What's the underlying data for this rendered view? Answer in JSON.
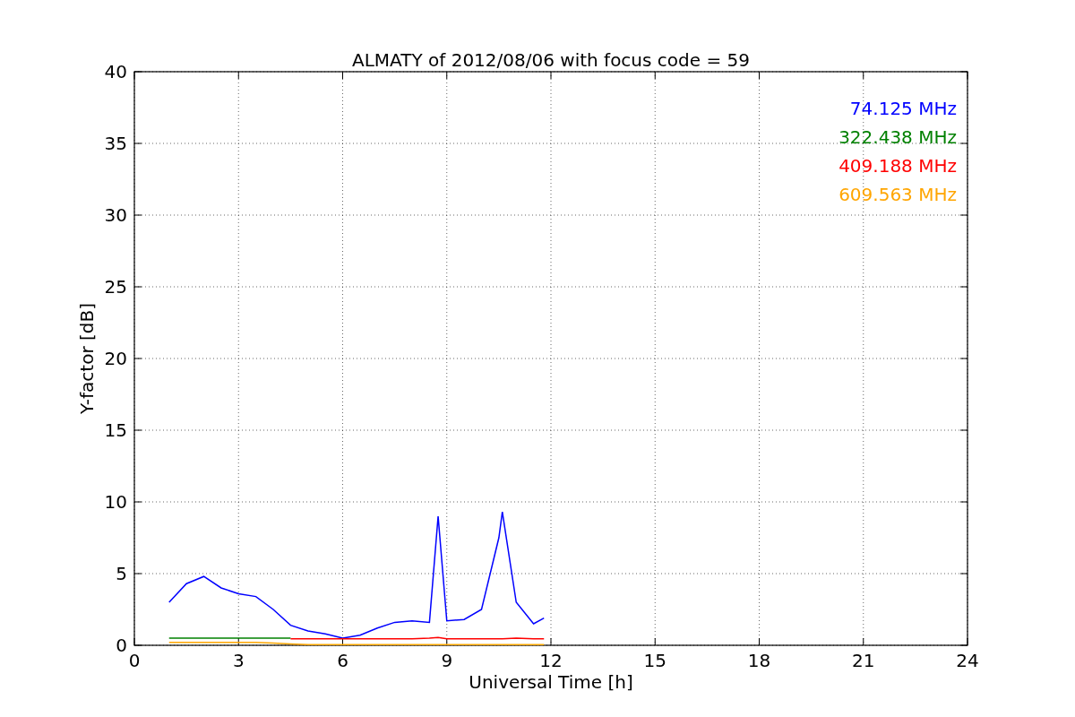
{
  "chart_data": {
    "type": "line",
    "title": "ALMATY of 2012/08/06 with focus code = 59",
    "xlabel": "Universal Time [h]",
    "ylabel": "Y-factor [dB]",
    "x": [
      1,
      1.5,
      2,
      2.5,
      3,
      3.5,
      4,
      4.5,
      5,
      5.5,
      6,
      6.5,
      7,
      7.5,
      8,
      8.5,
      8.75,
      9,
      9.5,
      10,
      10.5,
      10.6,
      11,
      11.5,
      11.8
    ],
    "series": [
      {
        "name": "74.125 MHz",
        "color": "#0000ff",
        "values": [
          3.0,
          4.3,
          4.8,
          4.0,
          3.6,
          3.4,
          2.5,
          1.4,
          1.0,
          0.8,
          0.5,
          0.7,
          1.2,
          1.6,
          1.7,
          1.6,
          9.0,
          1.7,
          1.8,
          2.5,
          7.5,
          9.3,
          3.0,
          1.5,
          1.9
        ]
      },
      {
        "name": "322.438 MHz",
        "color": "#008000",
        "values": [
          0.5,
          0.5,
          0.5,
          0.5,
          0.5,
          0.5,
          0.5,
          0.5,
          null,
          null,
          null,
          null,
          null,
          null,
          null,
          null,
          null,
          null,
          null,
          null,
          null,
          null,
          null,
          null,
          null
        ]
      },
      {
        "name": "409.188 MHz",
        "color": "#ff0000",
        "values": [
          null,
          null,
          null,
          null,
          null,
          null,
          null,
          0.45,
          0.45,
          0.45,
          0.45,
          0.45,
          0.45,
          0.45,
          0.45,
          0.5,
          0.55,
          0.45,
          0.45,
          0.45,
          0.45,
          0.45,
          0.5,
          0.45,
          0.45
        ]
      },
      {
        "name": "609.563 MHz",
        "color": "#ffa500",
        "values": [
          0.2,
          0.2,
          0.2,
          0.2,
          0.2,
          0.2,
          0.15,
          0.1,
          0.05,
          0.05,
          0.05,
          0.05,
          0.05,
          0.05,
          0.05,
          0.05,
          0.05,
          0.05,
          0.05,
          0.05,
          0.05,
          0.05,
          0.05,
          0.05,
          0.05
        ]
      }
    ],
    "grid": true,
    "xlim": [
      0,
      24
    ],
    "ylim": [
      0,
      40
    ],
    "xticks": [
      0,
      3,
      6,
      9,
      12,
      15,
      18,
      21,
      24
    ],
    "yticks": [
      0,
      5,
      10,
      15,
      20,
      25,
      30,
      35,
      40
    ]
  }
}
